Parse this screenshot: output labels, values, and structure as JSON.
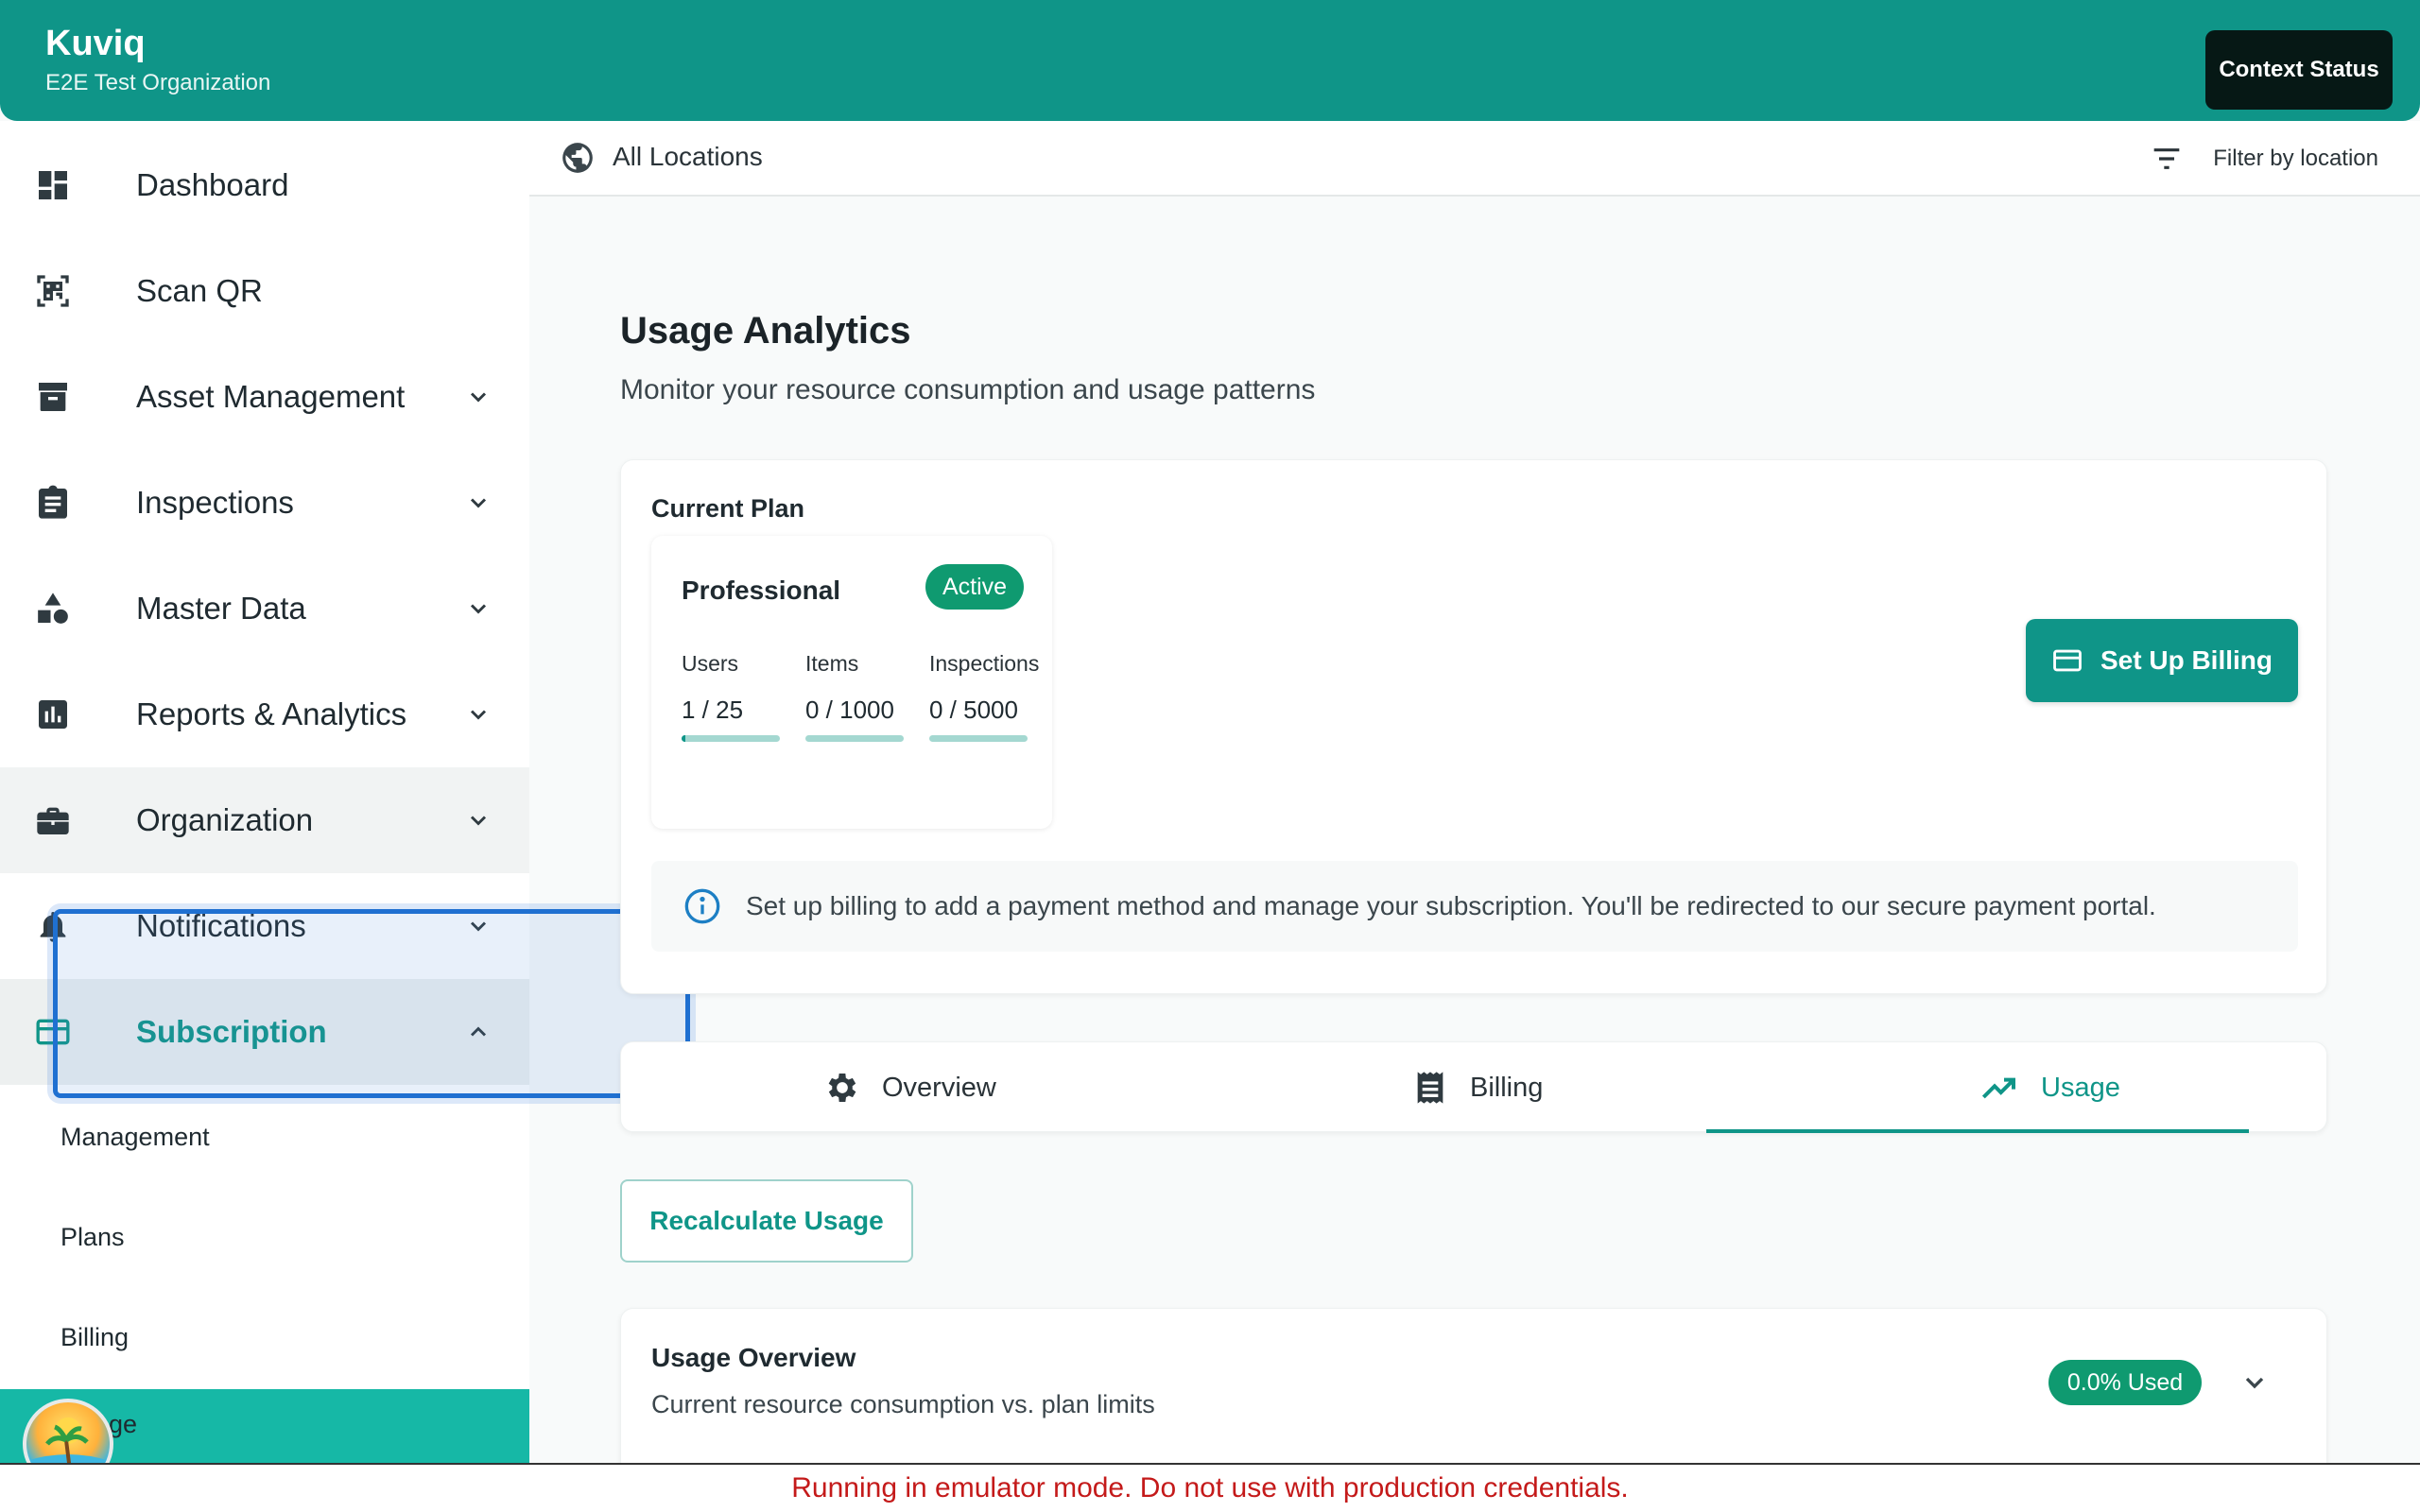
{
  "header": {
    "brand": "Kuviq",
    "organization": "E2E Test Organization",
    "context_status_label": "Context Status",
    "background_color": "#0f9588"
  },
  "sidebar": {
    "items": [
      {
        "label": "Dashboard",
        "icon": "dashboard-icon",
        "expandable": false
      },
      {
        "label": "Scan QR",
        "icon": "qr-scan-icon",
        "expandable": false
      },
      {
        "label": "Asset Management",
        "icon": "archive-icon",
        "expandable": true
      },
      {
        "label": "Inspections",
        "icon": "clipboard-icon",
        "expandable": true
      },
      {
        "label": "Master Data",
        "icon": "shapes-icon",
        "expandable": true
      },
      {
        "label": "Reports & Analytics",
        "icon": "bar-chart-icon",
        "expandable": true
      },
      {
        "label": "Organization",
        "icon": "briefcase-icon",
        "expandable": true
      },
      {
        "label": "Notifications",
        "icon": "bell-icon",
        "expandable": true
      },
      {
        "label": "Subscription",
        "icon": "credit-card-icon",
        "expandable": true,
        "expanded": true,
        "active": true
      }
    ],
    "sub_items": [
      "Management",
      "Plans",
      "Billing"
    ],
    "sub_active_partial": "ge"
  },
  "location_bar": {
    "location": "All Locations",
    "filter_label": "Filter by location"
  },
  "main": {
    "title": "Usage Analytics",
    "subtitle": "Monitor your resource consumption and usage patterns",
    "current_plan": {
      "heading": "Current Plan",
      "plan_name": "Professional",
      "status": "Active",
      "metrics": [
        {
          "label": "Users",
          "value": "1 / 25",
          "fraction": 0.04
        },
        {
          "label": "Items",
          "value": "0 / 1000",
          "fraction": 0
        },
        {
          "label": "Inspections",
          "value": "0 / 5000",
          "fraction": 0
        }
      ],
      "billing_button": "Set Up Billing",
      "info": "Set up billing to add a payment method and manage your subscription. You'll be redirected to our secure payment portal."
    },
    "tabs": [
      {
        "label": "Overview",
        "icon": "gear-icon"
      },
      {
        "label": "Billing",
        "icon": "receipt-icon"
      },
      {
        "label": "Usage",
        "icon": "trending-up-icon",
        "active": true
      }
    ],
    "recalculate_label": "Recalculate Usage",
    "usage_overview": {
      "title": "Usage Overview",
      "subtitle": "Current resource consumption vs. plan limits",
      "used_badge": "0.0% Used"
    }
  },
  "banner": {
    "text": "Running in emulator mode. Do not use with production credentials.",
    "color": "#c41a1a"
  },
  "colors": {
    "accent": "#0f9588",
    "success": "#0f9a70"
  }
}
